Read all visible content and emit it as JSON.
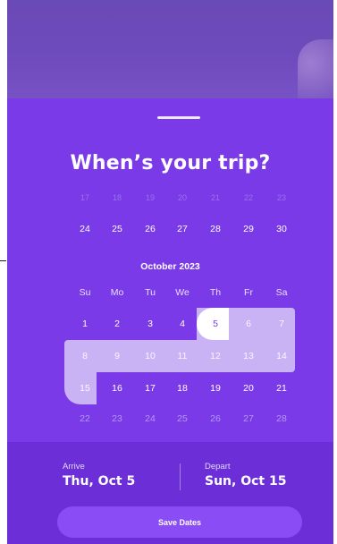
{
  "title": "When’s your trip?",
  "calendar": {
    "month_label": "October 2023",
    "weekdays": [
      "Su",
      "Mo",
      "Tu",
      "We",
      "Th",
      "Fr",
      "Sa"
    ],
    "row_prev_top": [
      "17",
      "18",
      "19",
      "20",
      "21",
      "22",
      "23"
    ],
    "row_prev": [
      "24",
      "25",
      "26",
      "27",
      "28",
      "29",
      "30"
    ],
    "row1": [
      "1",
      "2",
      "3",
      "4",
      "5",
      "6",
      "7"
    ],
    "row2": [
      "8",
      "9",
      "10",
      "11",
      "12",
      "13",
      "14"
    ],
    "row3": [
      "15",
      "16",
      "17",
      "18",
      "19",
      "20",
      "21"
    ],
    "row4": [
      "22",
      "23",
      "24",
      "25",
      "26",
      "27",
      "28"
    ]
  },
  "trip": {
    "arrive_label": "Arrive",
    "arrive_value": "Thu, Oct 5",
    "depart_label": "Depart",
    "depart_value": "Sun, Oct 15"
  },
  "actions": {
    "save_label": "Save Dates"
  },
  "colors": {
    "accent": "#7a3ae6",
    "range": "#c9b3f5",
    "button": "#8a4cf4"
  }
}
